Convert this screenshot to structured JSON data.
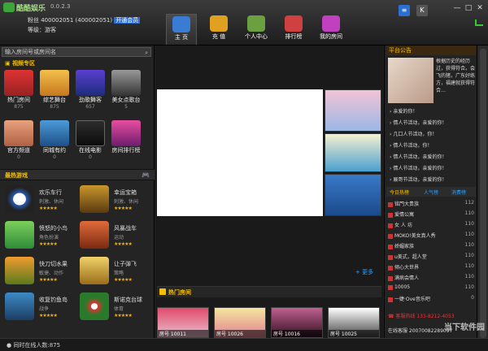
{
  "app": {
    "name": "酷酷娱乐",
    "version": "0.0.2.3"
  },
  "user": {
    "id_line": "粉丝 400002051 (400002051)",
    "vip": "开通会员",
    "level": "等级：游客"
  },
  "nav": [
    {
      "label": "主 页",
      "color": "#3a7bd5"
    },
    {
      "label": "充 值",
      "color": "#e0a020"
    },
    {
      "label": "个人中心",
      "color": "#6aa040"
    },
    {
      "label": "排行榜",
      "color": "#d04040"
    },
    {
      "label": "我的房间",
      "color": "#c040c0"
    }
  ],
  "search": {
    "placeholder": "输入房间号或房间名"
  },
  "video_zone": {
    "title": "视频专区",
    "tiles": [
      {
        "label": "热门房间",
        "count": "875"
      },
      {
        "label": "综艺舞台",
        "count": "875"
      },
      {
        "label": "劲歌舞客",
        "count": "657"
      },
      {
        "label": "美女点歌台",
        "count": "5"
      },
      {
        "label": "官方频道",
        "count": "0"
      },
      {
        "label": "同城有约",
        "count": "0"
      },
      {
        "label": "在线电影",
        "count": "0"
      },
      {
        "label": "房间排行榜",
        "count": ""
      }
    ]
  },
  "hot_games": {
    "title": "最热游戏",
    "games": [
      {
        "name": "欢乐车行",
        "sub": "刺激、休闲"
      },
      {
        "name": "幸运宝箱",
        "sub": "刺激、休闲"
      },
      {
        "name": "愤怒的小鸟",
        "sub": "角色扮演"
      },
      {
        "name": "风暴战车",
        "sub": "运动"
      },
      {
        "name": "快刀切水果",
        "sub": "敏捷、动作"
      },
      {
        "name": "让子弹飞",
        "sub": "策略"
      },
      {
        "name": "收复钓鱼岛",
        "sub": "战争"
      },
      {
        "name": "斯诺克台球",
        "sub": "体育"
      }
    ]
  },
  "center": {
    "more": "更多",
    "hot_rooms": "热门房间",
    "rooms": [
      {
        "label": "房号 10011"
      },
      {
        "label": "房号 10026"
      },
      {
        "label": "房号 10016"
      },
      {
        "label": "房号 10025"
      }
    ]
  },
  "right": {
    "notice_title": "平台公告",
    "notice_text": "根据历史的经历过，获得符合。会飞的猪，广东好练方，福建就获得符合…",
    "notices": [
      "亲爱的你！",
      "情人节活动，亲爱的你！",
      "几口人节活动，你！",
      "情人节活动，你！",
      "情人节活动，亲爱的你！",
      "情人节活动，亲爱的你！",
      "展哥节活动，亲爱的你！"
    ],
    "tabs": [
      "今日热榜",
      "人气榜",
      "消费榜"
    ],
    "ranks": [
      {
        "name": "铭門大贵族",
        "n": "112"
      },
      {
        "name": "爱情公寓",
        "n": "110"
      },
      {
        "name": "女 人 坊",
        "n": "110"
      },
      {
        "name": "MOKO!美女真人秀",
        "n": "110"
      },
      {
        "name": "娇媚家族",
        "n": "110"
      },
      {
        "name": "u美式，超人堂",
        "n": "110"
      },
      {
        "name": "倾心大世界",
        "n": "110"
      },
      {
        "name": "满病会情人",
        "n": "110"
      },
      {
        "name": "10005",
        "n": "110"
      },
      {
        "name": "一婕·Ove音乐吧",
        "n": "0"
      }
    ],
    "hotline": "客服热线 133-8212-4053",
    "cs": "在线客服 20070082289097"
  },
  "status": {
    "online": "同时在线人数:875"
  },
  "watermark": "当下软件园"
}
